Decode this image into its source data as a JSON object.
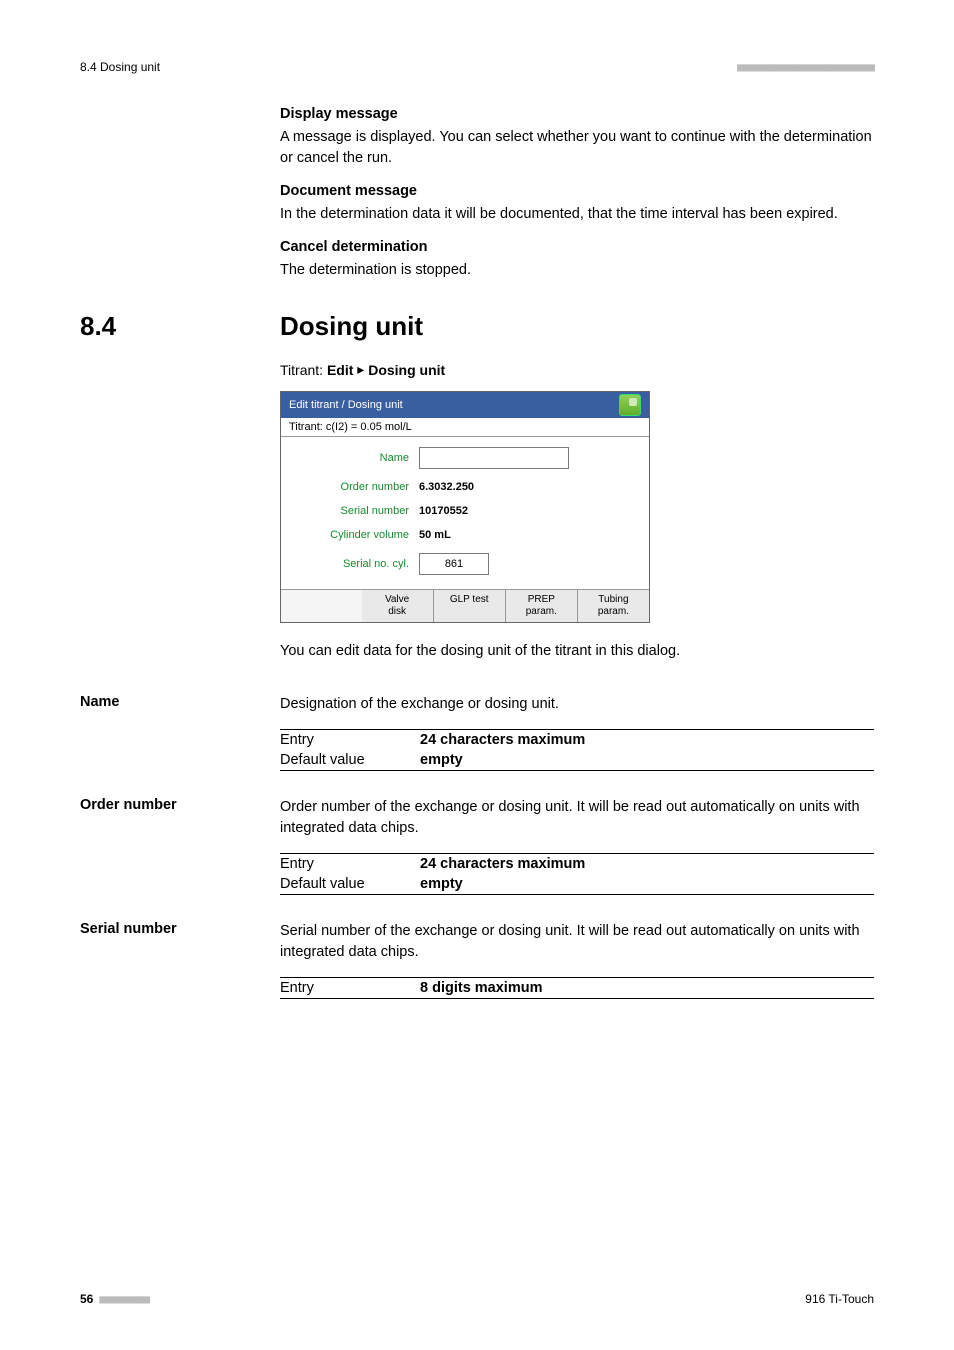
{
  "header": {
    "left": "8.4 Dosing unit",
    "right_dashes": "■■■■■■■■■■■■■■■■■■■■■■"
  },
  "top_blocks": {
    "display_msg_title": "Display message",
    "display_msg_text": "A message is displayed. You can select whether you want to continue with the determination or cancel the run.",
    "document_msg_title": "Document message",
    "document_msg_text": "In the determination data it will be documented, that the time interval has been expired.",
    "cancel_title": "Cancel determination",
    "cancel_text": "The determination is stopped."
  },
  "section": {
    "number": "8.4",
    "title": "Dosing unit",
    "breadcrumb_prefix": "Titrant: ",
    "breadcrumb_edit": "Edit",
    "breadcrumb_arrow": "▸",
    "breadcrumb_dosing": "Dosing unit"
  },
  "figure": {
    "header": "Edit titrant / Dosing unit",
    "sub": "Titrant: c(I2) = 0.05 mol/L",
    "rows": {
      "name_label": "Name",
      "name_value": "",
      "order_label": "Order number",
      "order_value": "6.3032.250",
      "serial_label": "Serial number",
      "serial_value": "10170552",
      "cyl_label": "Cylinder volume",
      "cyl_value": "50 mL",
      "serial_cyl_label": "Serial no. cyl.",
      "serial_cyl_value": "861"
    },
    "buttons": {
      "valve": "Valve\ndisk",
      "glp": "GLP test",
      "prep": "PREP\nparam.",
      "tubing": "Tubing\nparam."
    }
  },
  "after_figure_text": "You can edit data for the dosing unit of the titrant in this dialog.",
  "name_block": {
    "label": "Name",
    "desc": "Designation of the exchange or dosing unit.",
    "entry_k": "Entry",
    "entry_v": "24 characters maximum",
    "default_k": "Default value",
    "default_v": "empty"
  },
  "order_block": {
    "label": "Order number",
    "desc": "Order number of the exchange or dosing unit. It will be read out automatically on units with integrated data chips.",
    "entry_k": "Entry",
    "entry_v": "24 characters maximum",
    "default_k": "Default value",
    "default_v": "empty"
  },
  "serial_block": {
    "label": "Serial number",
    "desc": "Serial number of the exchange or dosing unit. It will be read out automatically on units with integrated data chips.",
    "entry_k": "Entry",
    "entry_v": "8 digits maximum"
  },
  "footer": {
    "page": "56",
    "dashes": "■■■■■■■■",
    "right": "916 Ti-Touch"
  }
}
